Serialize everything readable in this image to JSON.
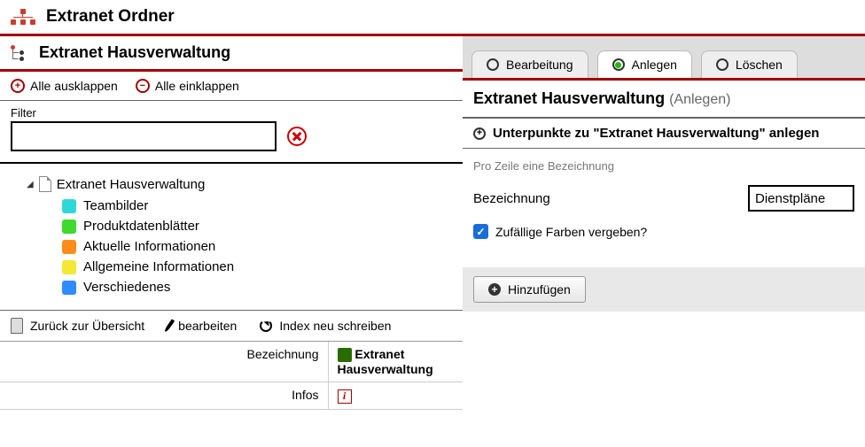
{
  "top_title": "Extranet Ordner",
  "section_title": "Extranet Hausverwaltung",
  "toolbar": {
    "expand_all": "Alle ausklappen",
    "collapse_all": "Alle einklappen"
  },
  "filter": {
    "label": "Filter",
    "value": ""
  },
  "tree": {
    "root": "Extranet Hausverwaltung",
    "items": [
      {
        "label": "Teambilder",
        "color": "#2fd8d8"
      },
      {
        "label": "Produktdatenblätter",
        "color": "#3fd92f"
      },
      {
        "label": "Aktuelle Informationen",
        "color": "#ff8c1a"
      },
      {
        "label": "Allgemeine Informationen",
        "color": "#f5e733"
      },
      {
        "label": "Verschiedenes",
        "color": "#2f8cff"
      }
    ]
  },
  "bottom": {
    "back": "Zurück zur Übersicht",
    "edit": "bearbeiten",
    "reindex": "Index neu schreiben"
  },
  "info": {
    "row1_label": "Bezeichnung",
    "row1_value": "Extranet Hausverwaltung",
    "row2_label": "Infos"
  },
  "tabs": {
    "edit": "Bearbeitung",
    "create": "Anlegen",
    "delete": "Löschen"
  },
  "right": {
    "title": "Extranet Hausverwaltung",
    "title_sub": "(Anlegen)",
    "accordion": "Unterpunkte zu \"Extranet Hausverwaltung\" anlegen",
    "hint": "Pro Zeile eine Bezeichnung",
    "field_label": "Bezeichnung",
    "field_value": "Dienstpläne",
    "checkbox_label": "Zufällige Farben vergeben?",
    "add_button": "Hinzufügen"
  }
}
